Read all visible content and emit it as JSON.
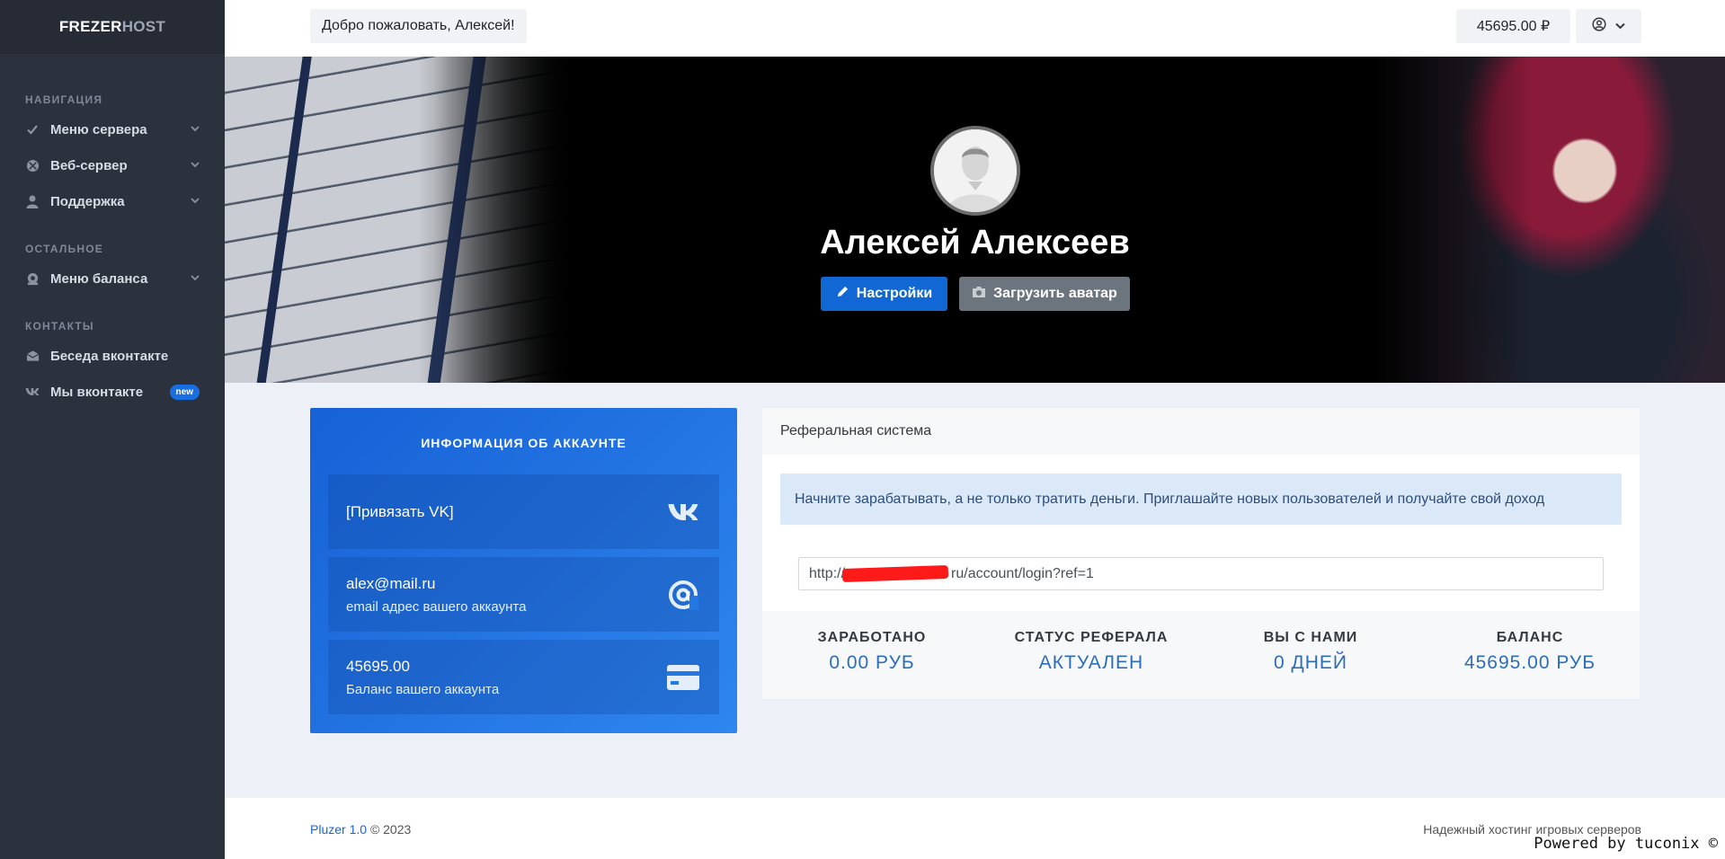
{
  "sidebar": {
    "logo_part1": "FREZER",
    "logo_part2": "HOST",
    "sections": [
      {
        "heading": "НАВИГАЦИЯ",
        "items": [
          {
            "label": "Меню сервера",
            "icon": "check-icon"
          },
          {
            "label": "Веб-сервер",
            "icon": "globe-icon"
          },
          {
            "label": "Поддержка",
            "icon": "user-icon"
          }
        ]
      },
      {
        "heading": "ОСТАЛЬНОЕ",
        "items": [
          {
            "label": "Меню баланса",
            "icon": "wallet-icon"
          }
        ]
      },
      {
        "heading": "КОНТАКТЫ",
        "items": [
          {
            "label": "Беседа вконтакте",
            "icon": "chat-icon"
          },
          {
            "label": "Мы вконтакте",
            "icon": "vk-icon",
            "badge": "new"
          }
        ]
      }
    ]
  },
  "header": {
    "welcome": "Добро пожаловать, Алексей!",
    "balance": "45695.00 ₽"
  },
  "profile": {
    "name": "Алексей Алексеев",
    "settings_button": "Настройки",
    "upload_button": "Загрузить аватар"
  },
  "account": {
    "title": "ИНФОРМАЦИЯ ОБ АККАУНТЕ",
    "vk_link": "[Привязать VK]",
    "email": "alex@mail.ru",
    "email_sub": "email адрес вашего аккаунта",
    "balance": "45695.00",
    "balance_sub": "Баланс вашего аккаунта"
  },
  "referral": {
    "title": "Реферальная система",
    "alert": "Начните зарабатывать, а не только тратить деньги. Приглашайте новых пользователей и получайте свой доход",
    "link_prefix": "http://",
    "link_suffix": "ru/account/login?ref=1",
    "stats": [
      {
        "label": "ЗАРАБОТАНО",
        "value": "0.00 РУБ"
      },
      {
        "label": "СТАТУС РЕФЕРАЛА",
        "value": "АКТУАЛЕН"
      },
      {
        "label": "ВЫ С НАМИ",
        "value": "0 ДНЕЙ"
      },
      {
        "label": "БАЛАНС",
        "value": "45695.00 РУБ"
      }
    ]
  },
  "footer": {
    "brand": "Pluzer 1.0",
    "copyright": "© 2023",
    "tagline": "Надежный хостинг игровых серверов",
    "powered": "Powered by tuconix ©"
  },
  "colors": {
    "sidebar_bg": "#2b313d",
    "accent": "#1168d4",
    "card_gradient_start": "#1661d6",
    "card_gradient_end": "#2f86ef",
    "stat_value": "#2d6db7"
  }
}
